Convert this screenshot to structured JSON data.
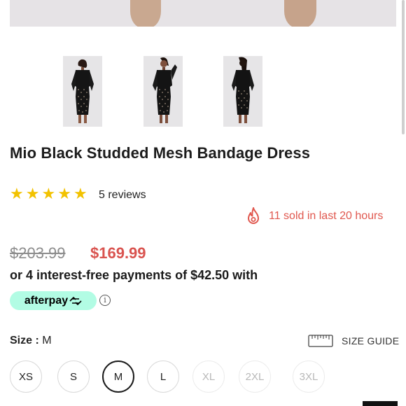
{
  "gallery": {
    "thumbnails": [
      {
        "icon": "dress-front-thumbnail"
      },
      {
        "icon": "dress-front-alt-thumbnail"
      },
      {
        "icon": "dress-back-thumbnail"
      }
    ]
  },
  "product": {
    "title": "Mio Black Studded Mesh Bandage Dress",
    "rating": 5,
    "reviews_label": "5 reviews",
    "sold_text": "11 sold in last 20 hours",
    "original_price": "$203.99",
    "sale_price": "$169.99",
    "installments_text": "or 4 interest-free payments of $42.50 with"
  },
  "afterpay": {
    "label": "afterpay",
    "info_glyph": "i",
    "color": "#b2fce4"
  },
  "size": {
    "label": "Size :",
    "selected": "M",
    "guide_label": "SIZE GUIDE",
    "options": [
      {
        "label": "XS",
        "state": "available"
      },
      {
        "label": "S",
        "state": "available"
      },
      {
        "label": "M",
        "state": "selected"
      },
      {
        "label": "L",
        "state": "available"
      },
      {
        "label": "XL",
        "state": "disabled"
      },
      {
        "label": "2XL",
        "state": "disabled"
      },
      {
        "label": "3XL",
        "state": "disabled"
      }
    ]
  },
  "colors": {
    "sale_red": "#d9534f",
    "star_yellow": "#f2c200"
  }
}
